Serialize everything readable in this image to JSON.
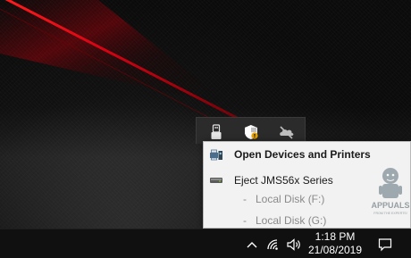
{
  "context_menu": {
    "items": [
      {
        "label": "Open Devices and Printers",
        "icon": "devices-printers-icon",
        "bold": true
      },
      {
        "label": "Eject JMS56x Series",
        "icon": "usb-drive-icon",
        "bold": false
      }
    ],
    "subitems": [
      {
        "dash": "-",
        "label": "Local Disk (F:)"
      },
      {
        "dash": "-",
        "label": "Local Disk (G:)"
      }
    ]
  },
  "tray_overflow": {
    "icons": [
      "usb-safely-remove-icon",
      "windows-defender-shield-icon",
      "onedrive-offline-icon"
    ]
  },
  "watermark": {
    "brand": "APPUALS",
    "tagline": "FROM THE EXPERTS!"
  },
  "taskbar": {
    "icons": [
      "show-hidden-icons-chevron-icon",
      "wifi-icon",
      "volume-icon",
      "action-center-icon"
    ],
    "time": "1:18 PM",
    "date": "21/08/2019"
  },
  "colors": {
    "menu_background": "#f2f2f2",
    "taskbar_background": "#101010",
    "wallpaper_accent": "#c8000a"
  }
}
